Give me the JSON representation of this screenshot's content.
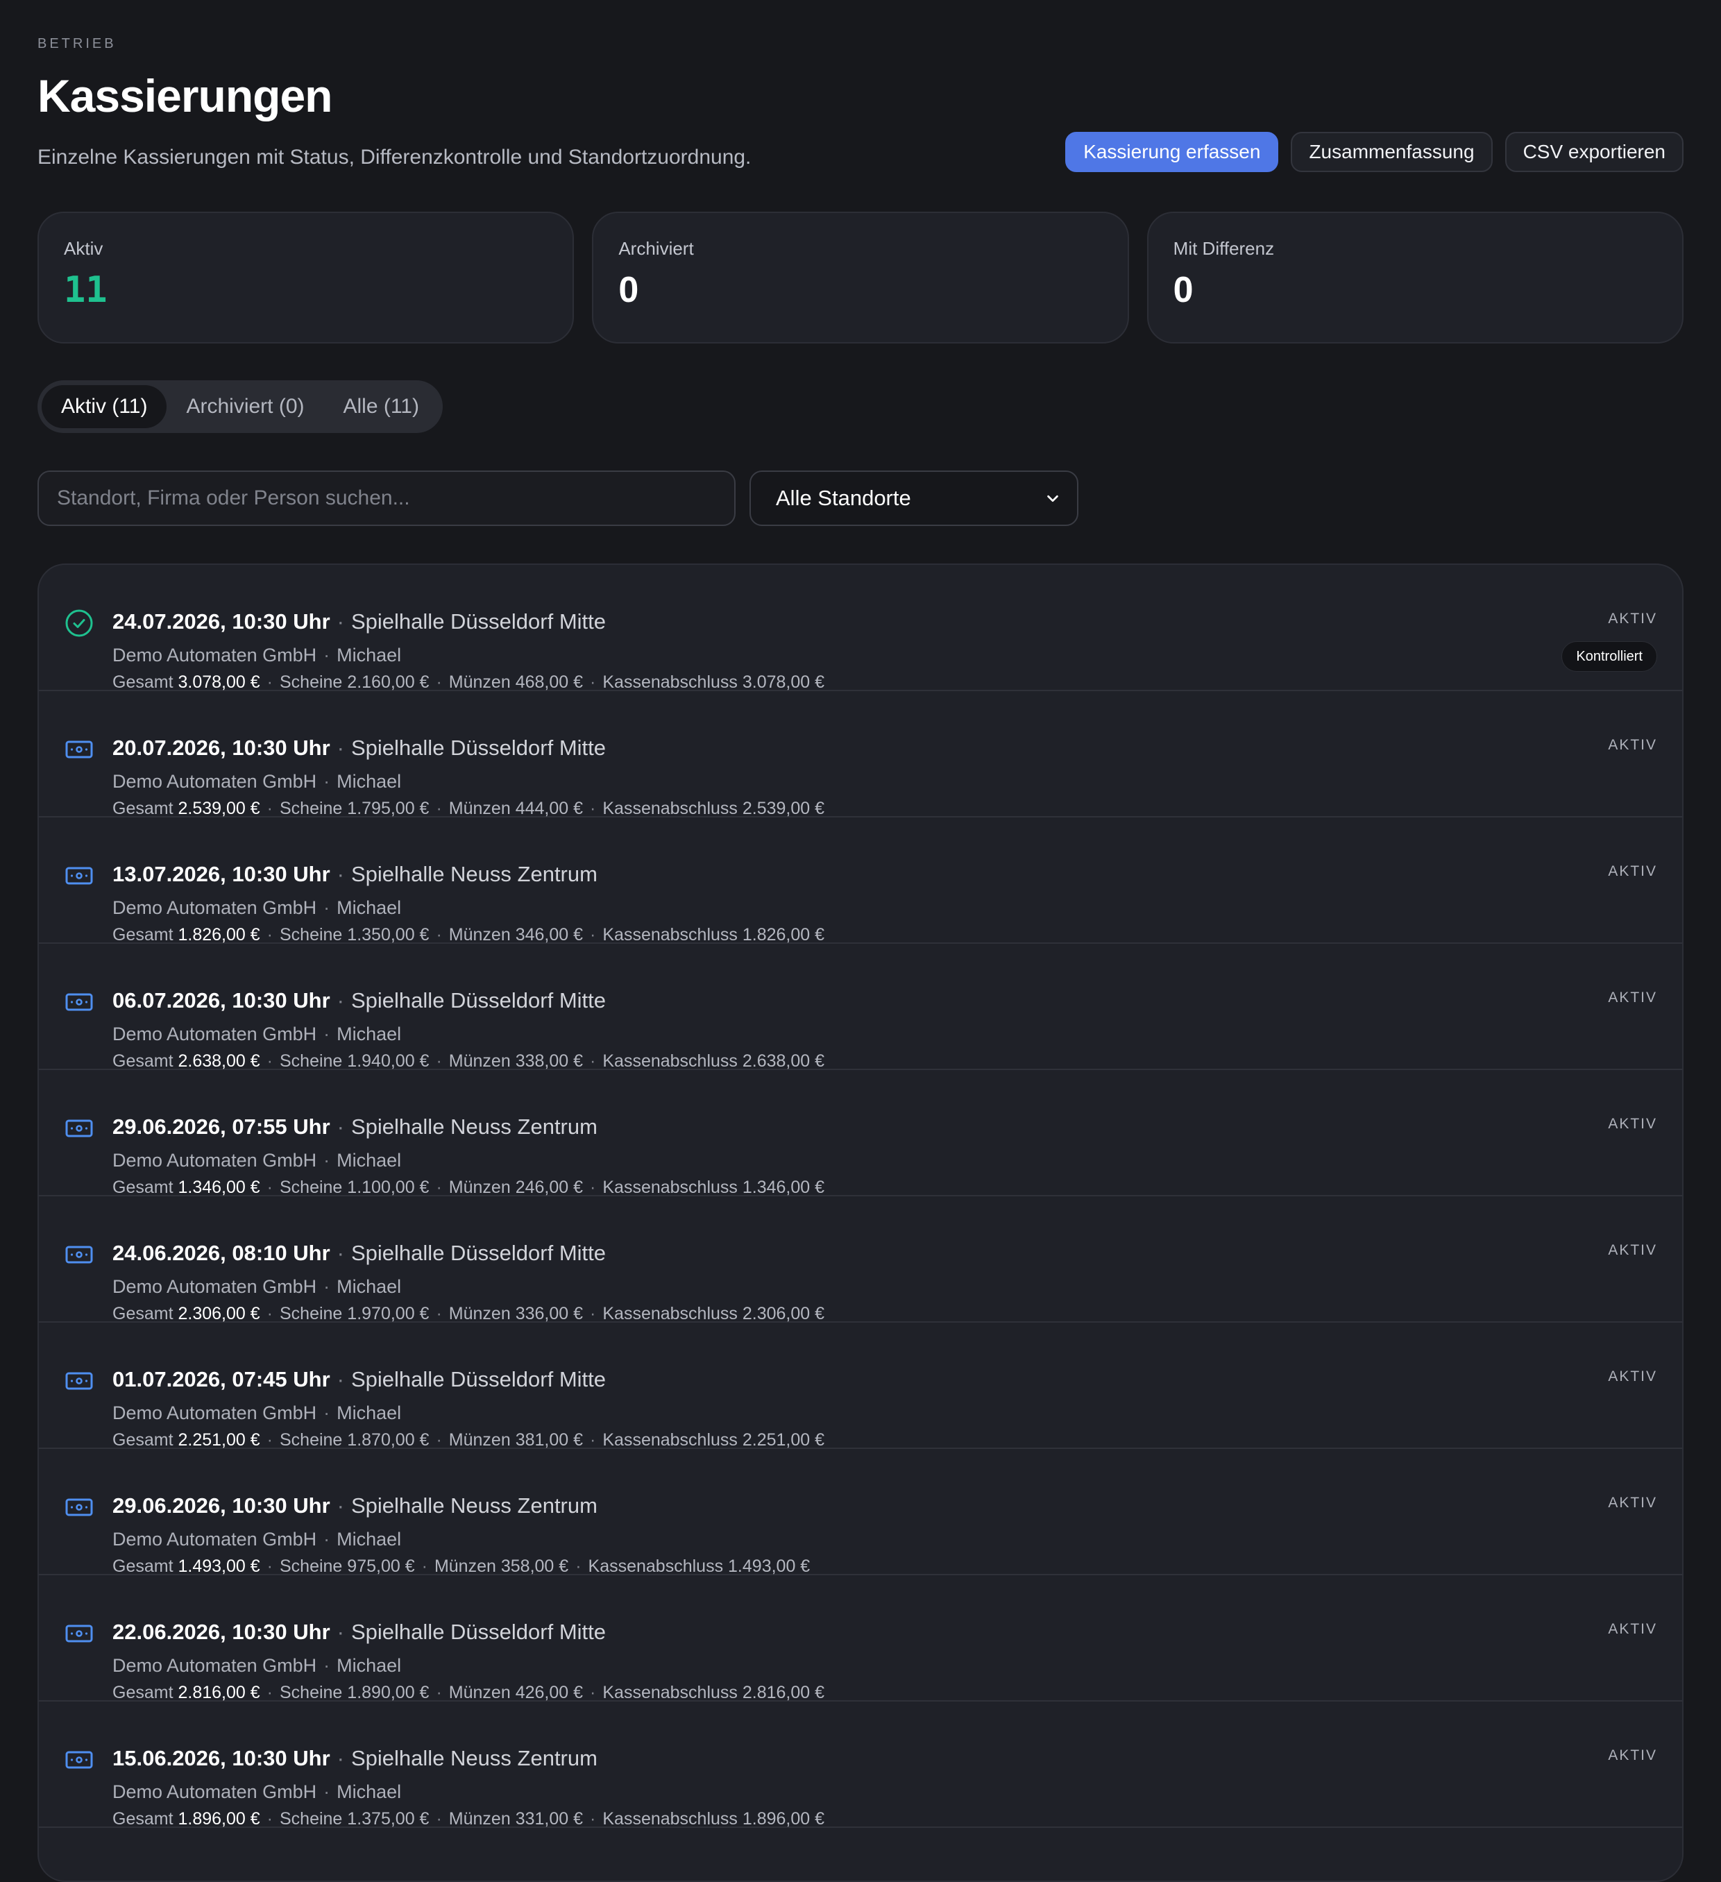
{
  "header": {
    "eyebrow": "BETRIEB",
    "title": "Kassierungen",
    "subtitle": "Einzelne Kassierungen mit Status, Differenzkontrolle und Standortzuordnung."
  },
  "actions": {
    "primary": "Kassierung erfassen",
    "summary": "Zusammenfassung",
    "export": "CSV exportieren"
  },
  "stats": [
    {
      "label": "Aktiv",
      "value": "11"
    },
    {
      "label": "Archiviert",
      "value": "0"
    },
    {
      "label": "Mit Differenz",
      "value": "0"
    }
  ],
  "tabs": [
    {
      "label": "Aktiv (11)"
    },
    {
      "label": "Archiviert (0)"
    },
    {
      "label": "Alle (11)"
    }
  ],
  "filters": {
    "search_placeholder": "Standort, Firma oder Person suchen...",
    "search_value": "",
    "location_selected": "Alle Standorte"
  },
  "labels": {
    "gesamt": "Gesamt",
    "scheine": "Scheine",
    "muenzen": "Münzen",
    "kassenabschluss": "Kassenabschluss"
  },
  "colors": {
    "accent": "#4f77e6",
    "success": "#1fc18f",
    "icon_blue": "#4f8ff0"
  },
  "rows": [
    {
      "icon": "check-circle-icon",
      "date": "24.07.2026, 10:30 Uhr",
      "location": "Spielhalle Düsseldorf Mitte",
      "company": "Demo Automaten GmbH",
      "person": "Michael",
      "gesamt": "3.078,00 €",
      "scheine": "2.160,00 €",
      "muenzen": "468,00 €",
      "kassenabschluss": "3.078,00 €",
      "status": "AKTIV",
      "badge": "Kontrolliert"
    },
    {
      "icon": "banknote-icon",
      "date": "20.07.2026, 10:30 Uhr",
      "location": "Spielhalle Düsseldorf Mitte",
      "company": "Demo Automaten GmbH",
      "person": "Michael",
      "gesamt": "2.539,00 €",
      "scheine": "1.795,00 €",
      "muenzen": "444,00 €",
      "kassenabschluss": "2.539,00 €",
      "status": "AKTIV"
    },
    {
      "icon": "banknote-icon",
      "date": "13.07.2026, 10:30 Uhr",
      "location": "Spielhalle Neuss Zentrum",
      "company": "Demo Automaten GmbH",
      "person": "Michael",
      "gesamt": "1.826,00 €",
      "scheine": "1.350,00 €",
      "muenzen": "346,00 €",
      "kassenabschluss": "1.826,00 €",
      "status": "AKTIV"
    },
    {
      "icon": "banknote-icon",
      "date": "06.07.2026, 10:30 Uhr",
      "location": "Spielhalle Düsseldorf Mitte",
      "company": "Demo Automaten GmbH",
      "person": "Michael",
      "gesamt": "2.638,00 €",
      "scheine": "1.940,00 €",
      "muenzen": "338,00 €",
      "kassenabschluss": "2.638,00 €",
      "status": "AKTIV"
    },
    {
      "icon": "banknote-icon",
      "date": "29.06.2026, 07:55 Uhr",
      "location": "Spielhalle Neuss Zentrum",
      "company": "Demo Automaten GmbH",
      "person": "Michael",
      "gesamt": "1.346,00 €",
      "scheine": "1.100,00 €",
      "muenzen": "246,00 €",
      "kassenabschluss": "1.346,00 €",
      "status": "AKTIV"
    },
    {
      "icon": "banknote-icon",
      "date": "24.06.2026, 08:10 Uhr",
      "location": "Spielhalle Düsseldorf Mitte",
      "company": "Demo Automaten GmbH",
      "person": "Michael",
      "gesamt": "2.306,00 €",
      "scheine": "1.970,00 €",
      "muenzen": "336,00 €",
      "kassenabschluss": "2.306,00 €",
      "status": "AKTIV"
    },
    {
      "icon": "banknote-icon",
      "date": "01.07.2026, 07:45 Uhr",
      "location": "Spielhalle Düsseldorf Mitte",
      "company": "Demo Automaten GmbH",
      "person": "Michael",
      "gesamt": "2.251,00 €",
      "scheine": "1.870,00 €",
      "muenzen": "381,00 €",
      "kassenabschluss": "2.251,00 €",
      "status": "AKTIV"
    },
    {
      "icon": "banknote-icon",
      "date": "29.06.2026, 10:30 Uhr",
      "location": "Spielhalle Neuss Zentrum",
      "company": "Demo Automaten GmbH",
      "person": "Michael",
      "gesamt": "1.493,00 €",
      "scheine": "975,00 €",
      "muenzen": "358,00 €",
      "kassenabschluss": "1.493,00 €",
      "status": "AKTIV"
    },
    {
      "icon": "banknote-icon",
      "date": "22.06.2026, 10:30 Uhr",
      "location": "Spielhalle Düsseldorf Mitte",
      "company": "Demo Automaten GmbH",
      "person": "Michael",
      "gesamt": "2.816,00 €",
      "scheine": "1.890,00 €",
      "muenzen": "426,00 €",
      "kassenabschluss": "2.816,00 €",
      "status": "AKTIV"
    },
    {
      "icon": "banknote-icon",
      "date": "15.06.2026, 10:30 Uhr",
      "location": "Spielhalle Neuss Zentrum",
      "company": "Demo Automaten GmbH",
      "person": "Michael",
      "gesamt": "1.896,00 €",
      "scheine": "1.375,00 €",
      "muenzen": "331,00 €",
      "kassenabschluss": "1.896,00 €",
      "status": "AKTIV"
    }
  ]
}
